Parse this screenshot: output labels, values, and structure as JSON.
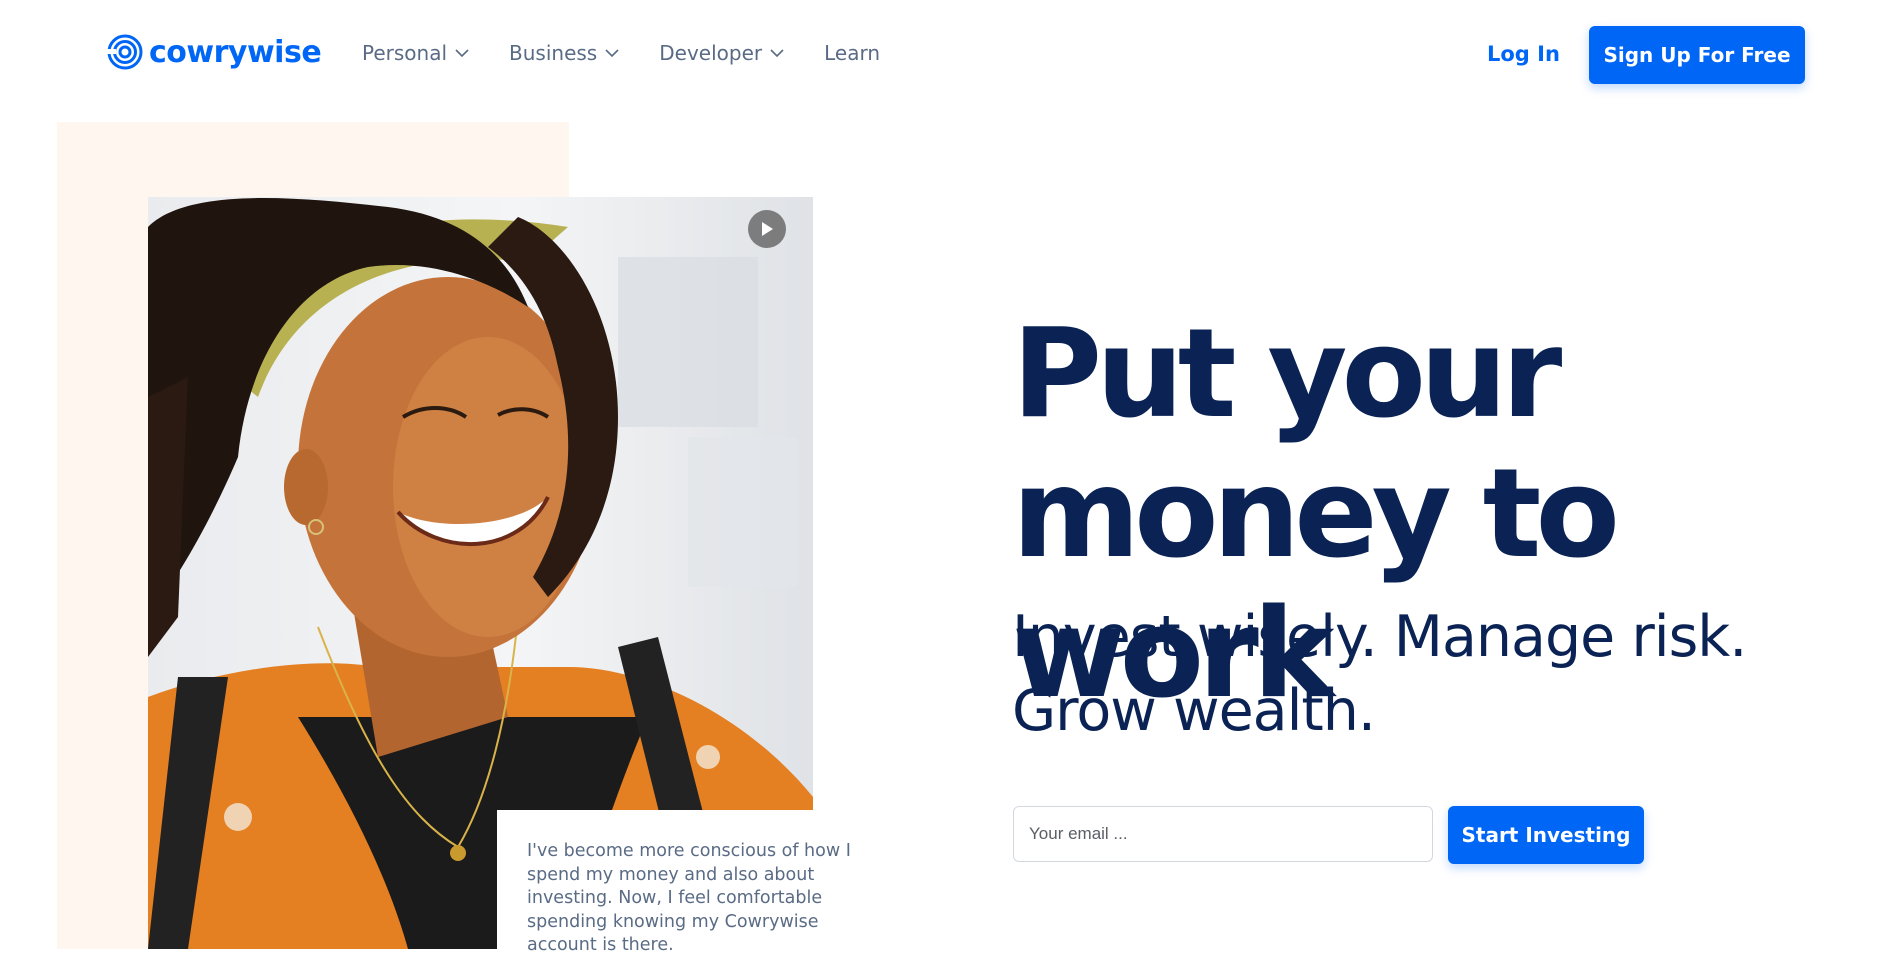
{
  "brand": {
    "name": "cowrywise",
    "accent_color": "#0066f5",
    "heading_color": "#0a2354",
    "logo_icon": "concentric-spiral-logo"
  },
  "nav": {
    "items": [
      {
        "label": "Personal",
        "icon": "chevron-down-icon"
      },
      {
        "label": "Business",
        "icon": "chevron-down-icon"
      },
      {
        "label": "Developer",
        "icon": "chevron-down-icon"
      },
      {
        "label": "Learn"
      }
    ],
    "login_label": "Log In",
    "signup_label": "Sign Up For Free"
  },
  "hero": {
    "headline_line1": "Put your",
    "headline_line2": "money to work",
    "subhead_line1": "Invest wisely. Manage risk.",
    "subhead_line2": "Grow wealth.",
    "email_placeholder": "Your email ...",
    "email_value": "",
    "cta_label": "Start Investing",
    "video_icon": "play-icon",
    "testimonial": "I've become more conscious of how I spend my money and also about investing. Now, I feel comfortable spending knowing my Cowrywise account is there."
  }
}
